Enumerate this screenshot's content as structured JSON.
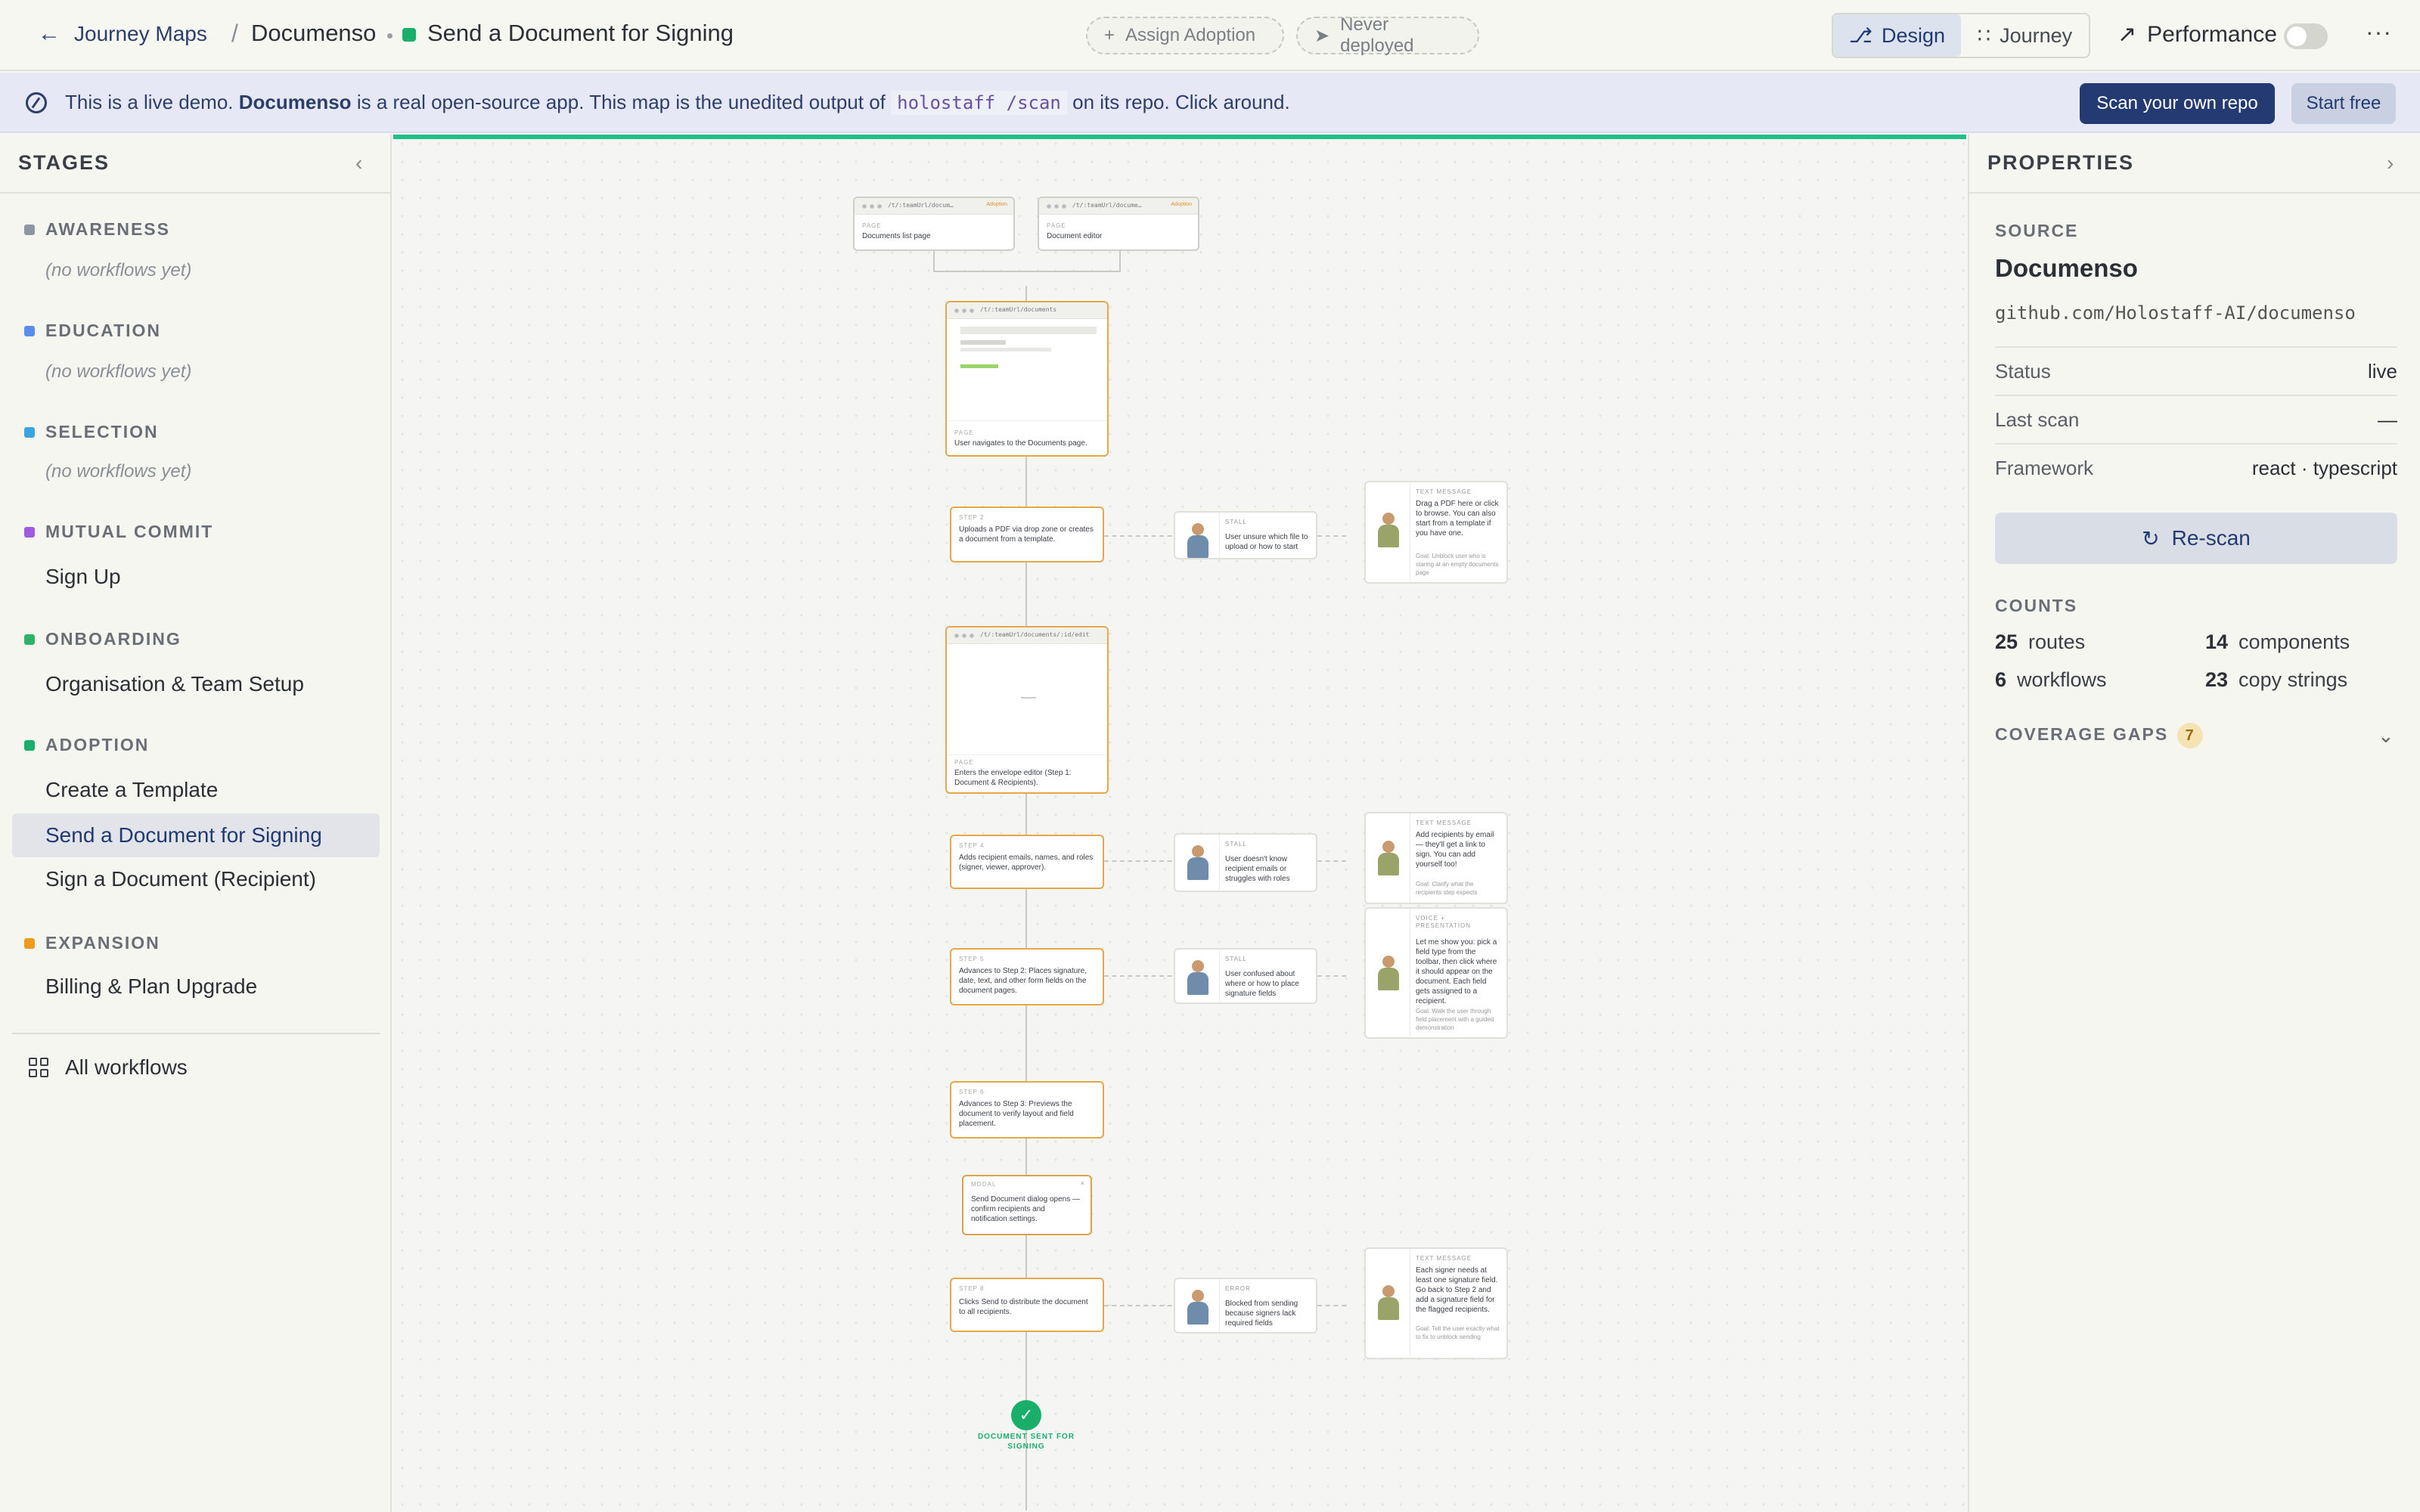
{
  "header": {
    "back_label": "Journey Maps",
    "separator": "/",
    "app_name": "Documenso",
    "workflow_title": "Send a Document for Signing",
    "assign_label": "Assign Adoption",
    "deploy_label": "Never deployed",
    "tabs": [
      {
        "label": "Design",
        "active": true
      },
      {
        "label": "Journey",
        "active": false
      }
    ],
    "performance_label": "Performance",
    "performance_on": false,
    "more_label": "···"
  },
  "banner": {
    "text_before": "This is a live demo.",
    "app_bold": "Documenso",
    "text_middle": "is a real open-source app. This map is the unedited output of",
    "command": "holostaff /scan",
    "text_after": "on its repo. Click around.",
    "scan_button": "Scan your own repo",
    "free_button": "Start free"
  },
  "sidebar": {
    "title": "STAGES",
    "empty_label": "(no workflows yet)",
    "stages": [
      {
        "name": "AWARENESS",
        "color": "#8e95a3",
        "workflows": []
      },
      {
        "name": "EDUCATION",
        "color": "#5b8def",
        "workflows": []
      },
      {
        "name": "SELECTION",
        "color": "#3aa6e0",
        "workflows": []
      },
      {
        "name": "MUTUAL COMMIT",
        "color": "#a05ae0",
        "workflows": [
          "Sign Up"
        ]
      },
      {
        "name": "ONBOARDING",
        "color": "#2fb36b",
        "workflows": [
          "Organisation & Team Setup"
        ]
      },
      {
        "name": "ADOPTION",
        "color": "#1aae6b",
        "workflows": [
          "Create a Template",
          "Send a Document for Signing",
          "Sign a Document (Recipient)"
        ]
      },
      {
        "name": "EXPANSION",
        "color": "#ef9a1a",
        "workflows": [
          "Billing & Plan Upgrade"
        ]
      }
    ],
    "all_workflows_label": "All workflows"
  },
  "canvas": {
    "accent_color": "#1fbf8a",
    "top_pages": [
      {
        "url": "/t/:teamUrl/docum…",
        "tag": "Adoption",
        "kind": "PAGE",
        "title": "Documents list page"
      },
      {
        "url": "/t/:teamUrl/docume…",
        "tag": "Adoption",
        "kind": "PAGE",
        "title": "Document editor"
      }
    ],
    "steps": [
      {
        "kind": "PAGE",
        "url": "/t/:teamUrl/documents",
        "text": "User navigates to the Documents page."
      },
      {
        "kind": "STEP 2",
        "text": "Uploads a PDF via drop zone or creates a document from a template."
      },
      {
        "kind": "PAGE",
        "url": "/t/:teamUrl/documents/:id/edit",
        "text": "Enters the envelope editor (Step 1: Document & Recipients)."
      },
      {
        "kind": "STEP 4",
        "text": "Adds recipient emails, names, and roles (signer, viewer, approver)."
      },
      {
        "kind": "STEP 5",
        "text": "Advances to Step 2: Places signature, date, text, and other form fields on the document pages."
      },
      {
        "kind": "STEP 6",
        "text": "Advances to Step 3: Previews the document to verify layout and field placement."
      },
      {
        "kind": "MODAL",
        "text": "Send Document dialog opens — confirm recipients and notification settings."
      },
      {
        "kind": "STEP 8",
        "text": "Clicks Send to distribute the document to all recipients."
      }
    ],
    "stalls": [
      {
        "kind": "STALL",
        "text": "User unsure which file to upload or how to start"
      },
      {
        "kind": "STALL",
        "text": "User doesn't know recipient emails or struggles with roles"
      },
      {
        "kind": "STALL",
        "text": "User confused about where or how to place signature fields"
      },
      {
        "kind": "ERROR",
        "text": "Blocked from sending because signers lack required fields"
      }
    ],
    "interventions": [
      {
        "kind": "TEXT MESSAGE",
        "text": "Drag a PDF here or click to browse. You can also start from a template if you have one.",
        "goal": "Goal: Unblock user who is staring at an empty documents page"
      },
      {
        "kind": "TEXT MESSAGE",
        "text": "Add recipients by email — they'll get a link to sign. You can add yourself too!",
        "goal": "Goal: Clarify what the recipients step expects"
      },
      {
        "kind": "VOICE + PRESENTATION",
        "text": "Let me show you: pick a field type from the toolbar, then click where it should appear on the document. Each field gets assigned to a recipient.",
        "goal": "Goal: Walk the user through field placement with a guided demonstration"
      },
      {
        "kind": "TEXT MESSAGE",
        "text": "Each signer needs at least one signature field. Go back to Step 2 and add a signature field for the flagged recipients.",
        "goal": "Goal: Tell the user exactly what to fix to unblock sending"
      }
    ],
    "end_check": "✓",
    "end_label": "DOCUMENT SENT FOR SIGNING"
  },
  "properties": {
    "title": "PROPERTIES",
    "source_label": "SOURCE",
    "source_name": "Documenso",
    "repo": "github.com/Holostaff-AI/documenso",
    "rows": [
      {
        "key": "Status",
        "value": "live"
      },
      {
        "key": "Last scan",
        "value": "—"
      },
      {
        "key": "Framework",
        "value": "react · typescript"
      }
    ],
    "rescan_label": "Re-scan",
    "counts_label": "COUNTS",
    "counts": [
      {
        "num": "25",
        "label": "routes"
      },
      {
        "num": "14",
        "label": "components"
      },
      {
        "num": "6",
        "label": "workflows"
      },
      {
        "num": "23",
        "label": "copy strings"
      }
    ],
    "coverage_label": "COVERAGE GAPS",
    "coverage_count": "7"
  }
}
